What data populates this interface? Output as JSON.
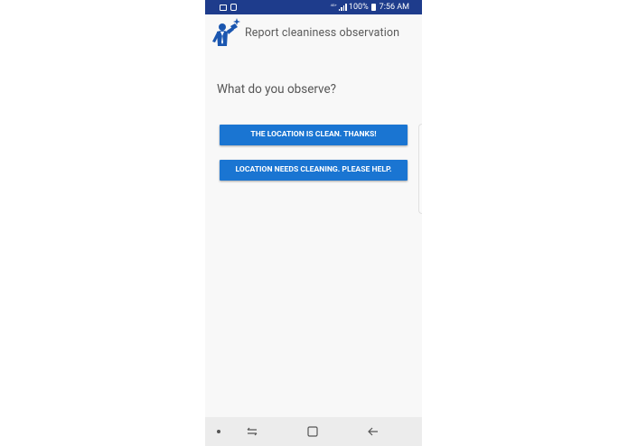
{
  "status_bar": {
    "left_icons": [
      "image-icon",
      "usb-icon"
    ],
    "network_label": "4G+",
    "battery_text": "100%",
    "time": "7:56 AM",
    "background_color": "#1e3c8c"
  },
  "header": {
    "title": "Report cleaniness observation",
    "logo_icon": "cleaner-mascot-icon",
    "logo_color": "#1a56b0"
  },
  "main": {
    "question": "What do you observe?",
    "buttons": [
      {
        "label": "THE LOCATION IS CLEAN. THANKS!"
      },
      {
        "label": "LOCATION NEEDS CLEANING. PLEASE HELP."
      }
    ],
    "button_color": "#1a75d2"
  },
  "nav_bar": {
    "items": [
      "dot-icon",
      "recents-icon",
      "home-icon",
      "back-icon"
    ]
  }
}
